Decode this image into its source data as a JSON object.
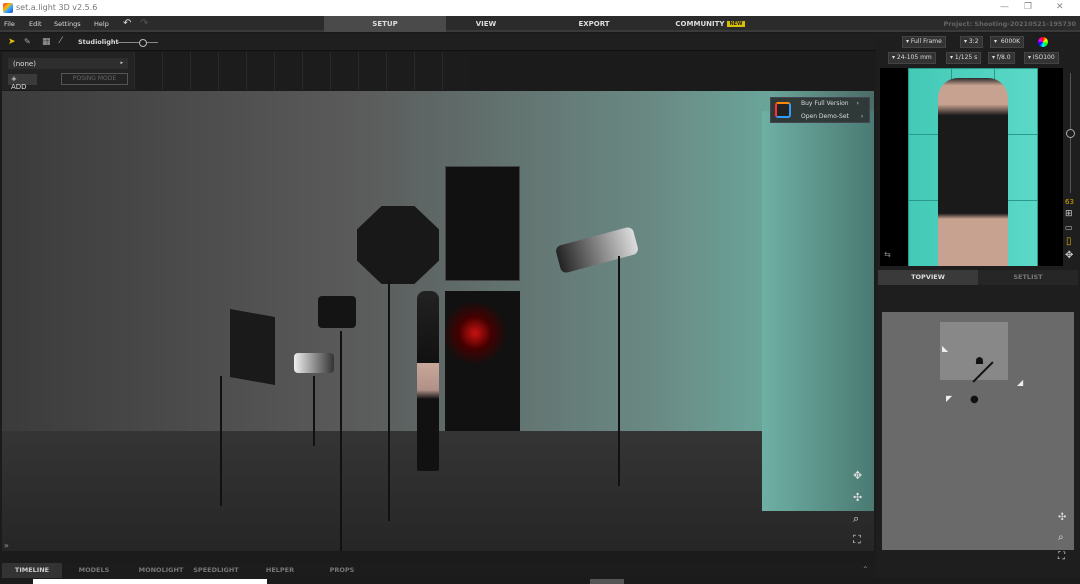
{
  "window": {
    "title": "set.a.light 3D v2.5.6",
    "minimize": "—",
    "restore": "❐",
    "close": "✕"
  },
  "menu": {
    "items": [
      "File",
      "Edit",
      "Settings",
      "Help"
    ],
    "undo_icon": "undo-icon",
    "redo_icon": "redo-icon"
  },
  "main_tabs": [
    {
      "label": "SETUP",
      "active": true
    },
    {
      "label": "VIEW"
    },
    {
      "label": "EXPORT"
    },
    {
      "label": "COMMUNITY",
      "badge": "NEW"
    }
  ],
  "project": "Project: Shooting-20210521-195730",
  "toolbar": {
    "studiolight_label": "Studiolight",
    "studiolight_level": 0.6
  },
  "left": {
    "pose_select": "(none)",
    "add": "ADD",
    "posing_mode": "POSING MODE"
  },
  "viewport": {
    "buy": "Buy Full Version",
    "demo": "Open Demo-Set"
  },
  "camera": {
    "sensor": "Full Frame",
    "ratio": "3:2",
    "white_balance": "6000K",
    "lens": "24-105 mm",
    "shutter": "1/125 s",
    "aperture": "f/8.0",
    "iso": "ISO100",
    "zoom_value": "63"
  },
  "right_tabs": [
    {
      "label": "TOPVIEW",
      "active": true
    },
    {
      "label": "SETLIST"
    }
  ],
  "bottom_tabs": [
    {
      "label": "TIMELINE",
      "active": true
    },
    {
      "label": "MODELS"
    },
    {
      "label": "MONOLIGHT"
    },
    {
      "label": "SPEEDLIGHT"
    },
    {
      "label": "HELPER"
    },
    {
      "label": "PROPS"
    }
  ],
  "colors": {
    "accent": "#d8c000",
    "teal": "#3fc7b5"
  }
}
